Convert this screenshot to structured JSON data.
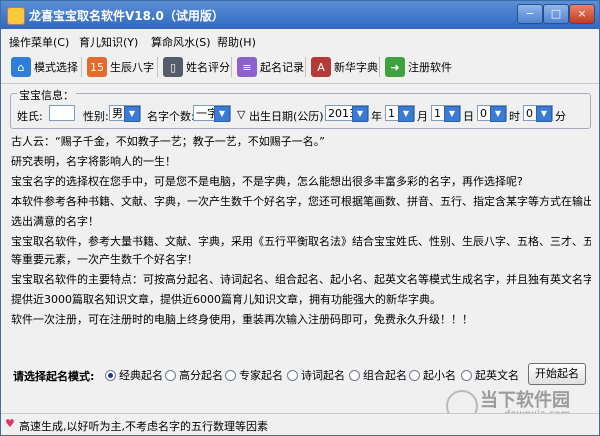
{
  "window": {
    "title": "龙喜宝宝取名软件V18.0（试用版）",
    "controls": {
      "minimize": "−",
      "maximize": "□",
      "close": "×"
    }
  },
  "menu": [
    {
      "label": "操作菜单(C)"
    },
    {
      "label": "育儿知识(Y)"
    },
    {
      "label": "算命风水(S)"
    },
    {
      "label": "帮助(H)"
    }
  ],
  "toolbar": [
    {
      "label": "模式选择",
      "icon": "house-icon",
      "color": "#2f7fd9",
      "glyph": "⌂"
    },
    {
      "label": "生辰八字",
      "icon": "calendar-icon",
      "color": "#e36c2c",
      "glyph": "15"
    },
    {
      "label": "姓名评分",
      "icon": "phone-icon",
      "color": "#555d6b",
      "glyph": "▯"
    },
    {
      "label": "起名记录",
      "icon": "notebook-icon",
      "color": "#8a62c9",
      "glyph": "≡"
    },
    {
      "label": "新华字典",
      "icon": "book-icon",
      "color": "#b53a3a",
      "glyph": "A"
    },
    {
      "label": "注册软件",
      "icon": "arrow-icon",
      "color": "#3ea23e",
      "glyph": "➜"
    }
  ],
  "form": {
    "group_title": "宝宝信息：",
    "surname_label": "姓氏:",
    "surname_value": "",
    "gender_label": "性别:",
    "gender_value": "男",
    "name_len_label": "名字个数:",
    "name_len_value": "一字",
    "birth_label": "出生日期(公历):",
    "year_value": "2013",
    "year_unit": "年",
    "month_value": "1",
    "month_unit": "月",
    "day_value": "1",
    "day_unit": "日",
    "hour_value": "0",
    "hour_unit": "时",
    "minute_value": "0",
    "minute_unit": "分"
  },
  "content_lines": [
    "古人云：“赐子千金，不如教子一艺；教子一艺，不如赐子一名。”",
    "研究表明，名字将影响人的一生！",
    "宝宝名字的选择权在您手中，可是您不是电脑，不是字典，怎么能想出很多丰富多彩的名字，再作选择呢?",
    "本软件参考各种书籍、文献、字典，一次产生数千个好名字，您还可根据笔画数、拼音、五行、指定含某字等方式在输出结果里筛",
    "选出满意的名字！",
    "宝宝取名软件，参考大量书籍、文献、字典，采用《五行平衡取名法》结合宝宝姓氏、性别、生辰八字、五格、三才、五行及音行意",
    "等重要元素，一次产生数千个好名字！",
    "宝宝取名软件的主要特点：可按高分起名、诗词起名、组合起名、起小名、起英文名等模式生成名字，并且独有英文名字朗读功能。",
    "提供近3000篇取名知识文章，提供近6000篇育儿知识文章，拥有功能强大的新华字典。",
    "软件一次注册，可在注册时的电脑上终身使用，重装再次输入注册码即可，免费永久升级！！！"
  ],
  "modes": {
    "label": "请选择起名模式:",
    "options": [
      "经典起名",
      "高分起名",
      "专家起名",
      "诗词起名",
      "组合起名",
      "起小名",
      "起英文名"
    ],
    "selected": "经典起名",
    "start_button": "开始起名"
  },
  "status": {
    "text": "高速生成,以好听为主,不考虑名字的五行数理等因素"
  },
  "watermark": {
    "text": "当下软件园",
    "sub": "downxia.com"
  }
}
